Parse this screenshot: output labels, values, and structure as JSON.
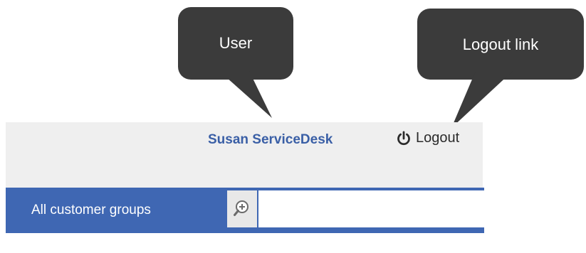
{
  "callouts": {
    "user": "User",
    "logout": "Logout link"
  },
  "header": {
    "user_name": "Susan ServiceDesk",
    "logout_label": "Logout",
    "logout_icon": "power-icon"
  },
  "nav": {
    "group_label": "All customer groups",
    "search_icon": "zoom-in-icon",
    "search_value": ""
  },
  "colors": {
    "callout_bg": "#3b3b3b",
    "header_bg": "#efefef",
    "nav_bg": "#3f67b3",
    "user_link": "#3a5fa6"
  }
}
